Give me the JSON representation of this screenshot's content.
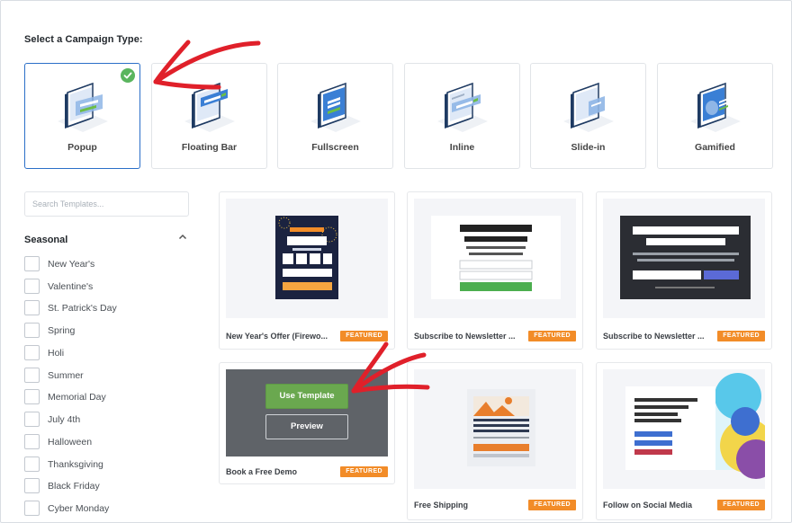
{
  "page": {
    "heading": "Select a Campaign Type:"
  },
  "campaign_types": [
    {
      "label": "Popup",
      "icon": "popup-type-icon",
      "selected": true
    },
    {
      "label": "Floating Bar",
      "icon": "floating-bar-type-icon",
      "selected": false
    },
    {
      "label": "Fullscreen",
      "icon": "fullscreen-type-icon",
      "selected": false
    },
    {
      "label": "Inline",
      "icon": "inline-type-icon",
      "selected": false
    },
    {
      "label": "Slide-in",
      "icon": "slide-in-type-icon",
      "selected": false
    },
    {
      "label": "Gamified",
      "icon": "gamified-type-icon",
      "selected": false
    }
  ],
  "search": {
    "placeholder": "Search Templates...",
    "value": ""
  },
  "categories": {
    "title": "Seasonal",
    "items": [
      {
        "label": "New Year's",
        "checked": false
      },
      {
        "label": "Valentine's",
        "checked": false
      },
      {
        "label": "St. Patrick's Day",
        "checked": false
      },
      {
        "label": "Spring",
        "checked": false
      },
      {
        "label": "Holi",
        "checked": false
      },
      {
        "label": "Summer",
        "checked": false
      },
      {
        "label": "Memorial Day",
        "checked": false
      },
      {
        "label": "July 4th",
        "checked": false
      },
      {
        "label": "Halloween",
        "checked": false
      },
      {
        "label": "Thanksgiving",
        "checked": false
      },
      {
        "label": "Black Friday",
        "checked": false
      },
      {
        "label": "Cyber Monday",
        "checked": false
      }
    ]
  },
  "templates": [
    {
      "name": "New Year's Offer (Firewo...",
      "badge": "FEATURED"
    },
    {
      "name": "Subscribe to Newsletter ...",
      "badge": "FEATURED"
    },
    {
      "name": "Subscribe to Newsletter ...",
      "badge": "FEATURED"
    },
    {
      "name": "Book a Free Demo",
      "badge": "FEATURED",
      "use_label": "Use Template",
      "preview_label": "Preview"
    },
    {
      "name": "Free Shipping",
      "badge": "FEATURED"
    },
    {
      "name": "Follow on Social Media",
      "badge": "FEATURED"
    }
  ],
  "colors": {
    "accent_blue": "#2b6fc8",
    "check_green": "#5ab55e",
    "badge_orange": "#f28c28",
    "use_green": "#6aa84f",
    "annotation_red": "#e0202a"
  }
}
